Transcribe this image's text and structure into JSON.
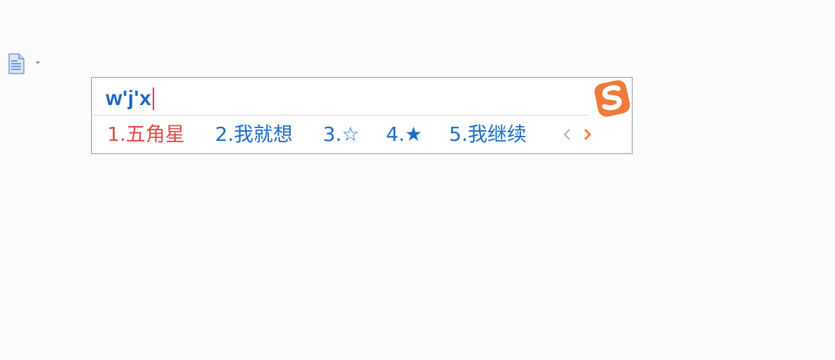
{
  "toolbar": {
    "doc_icon": "document-icon",
    "caret_icon": "caret-down-icon"
  },
  "ime": {
    "composition": "w'j'x",
    "logo_icon": "sogou-logo-icon",
    "candidates": [
      {
        "index": "1.",
        "text": "五角星",
        "selected": true
      },
      {
        "index": "2.",
        "text": "我就想",
        "selected": false
      },
      {
        "index": "3.",
        "text": "☆",
        "selected": false
      },
      {
        "index": "4.",
        "text": "★",
        "selected": false
      },
      {
        "index": "5.",
        "text": "我继续",
        "selected": false
      }
    ],
    "prev_icon": "chevron-left-icon",
    "next_icon": "chevron-right-icon",
    "colors": {
      "accent": "#1a6cc6",
      "selected": "#e8474a",
      "logo": "#f07a3a",
      "caret": "#e0343a"
    }
  }
}
